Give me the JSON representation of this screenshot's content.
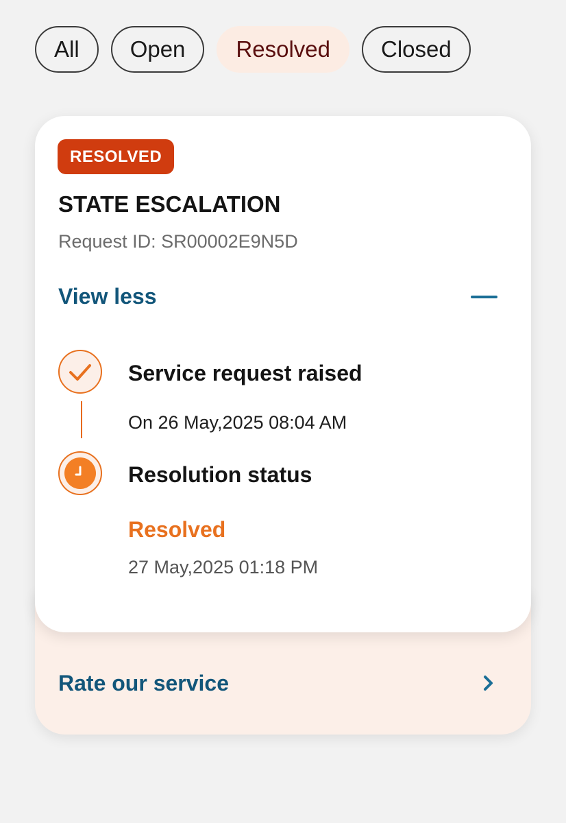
{
  "filters": [
    {
      "label": "All",
      "active": false
    },
    {
      "label": "Open",
      "active": false
    },
    {
      "label": "Resolved",
      "active": true
    },
    {
      "label": "Closed",
      "active": false
    }
  ],
  "card": {
    "badge": "RESOLVED",
    "title": "STATE ESCALATION",
    "request_id": "Request ID: SR00002E9N5D",
    "view_less": "View less",
    "collapse_icon": "minus-icon",
    "timeline": [
      {
        "icon": "check-circle-icon",
        "title": "Service request raised",
        "date": "On 26 May,2025 08:04 AM"
      },
      {
        "icon": "clock-circle-icon",
        "title": "Resolution status",
        "status": "Resolved",
        "date": "27 May,2025 01:18 PM"
      }
    ]
  },
  "rate": {
    "label": "Rate our service",
    "icon": "chevron-right-icon"
  },
  "colors": {
    "badge_bg": "#d03c0f",
    "accent_orange": "#e8711f",
    "link_blue": "#12567a",
    "chip_active_bg": "#fcece3",
    "rate_bg": "#fcefe8"
  }
}
